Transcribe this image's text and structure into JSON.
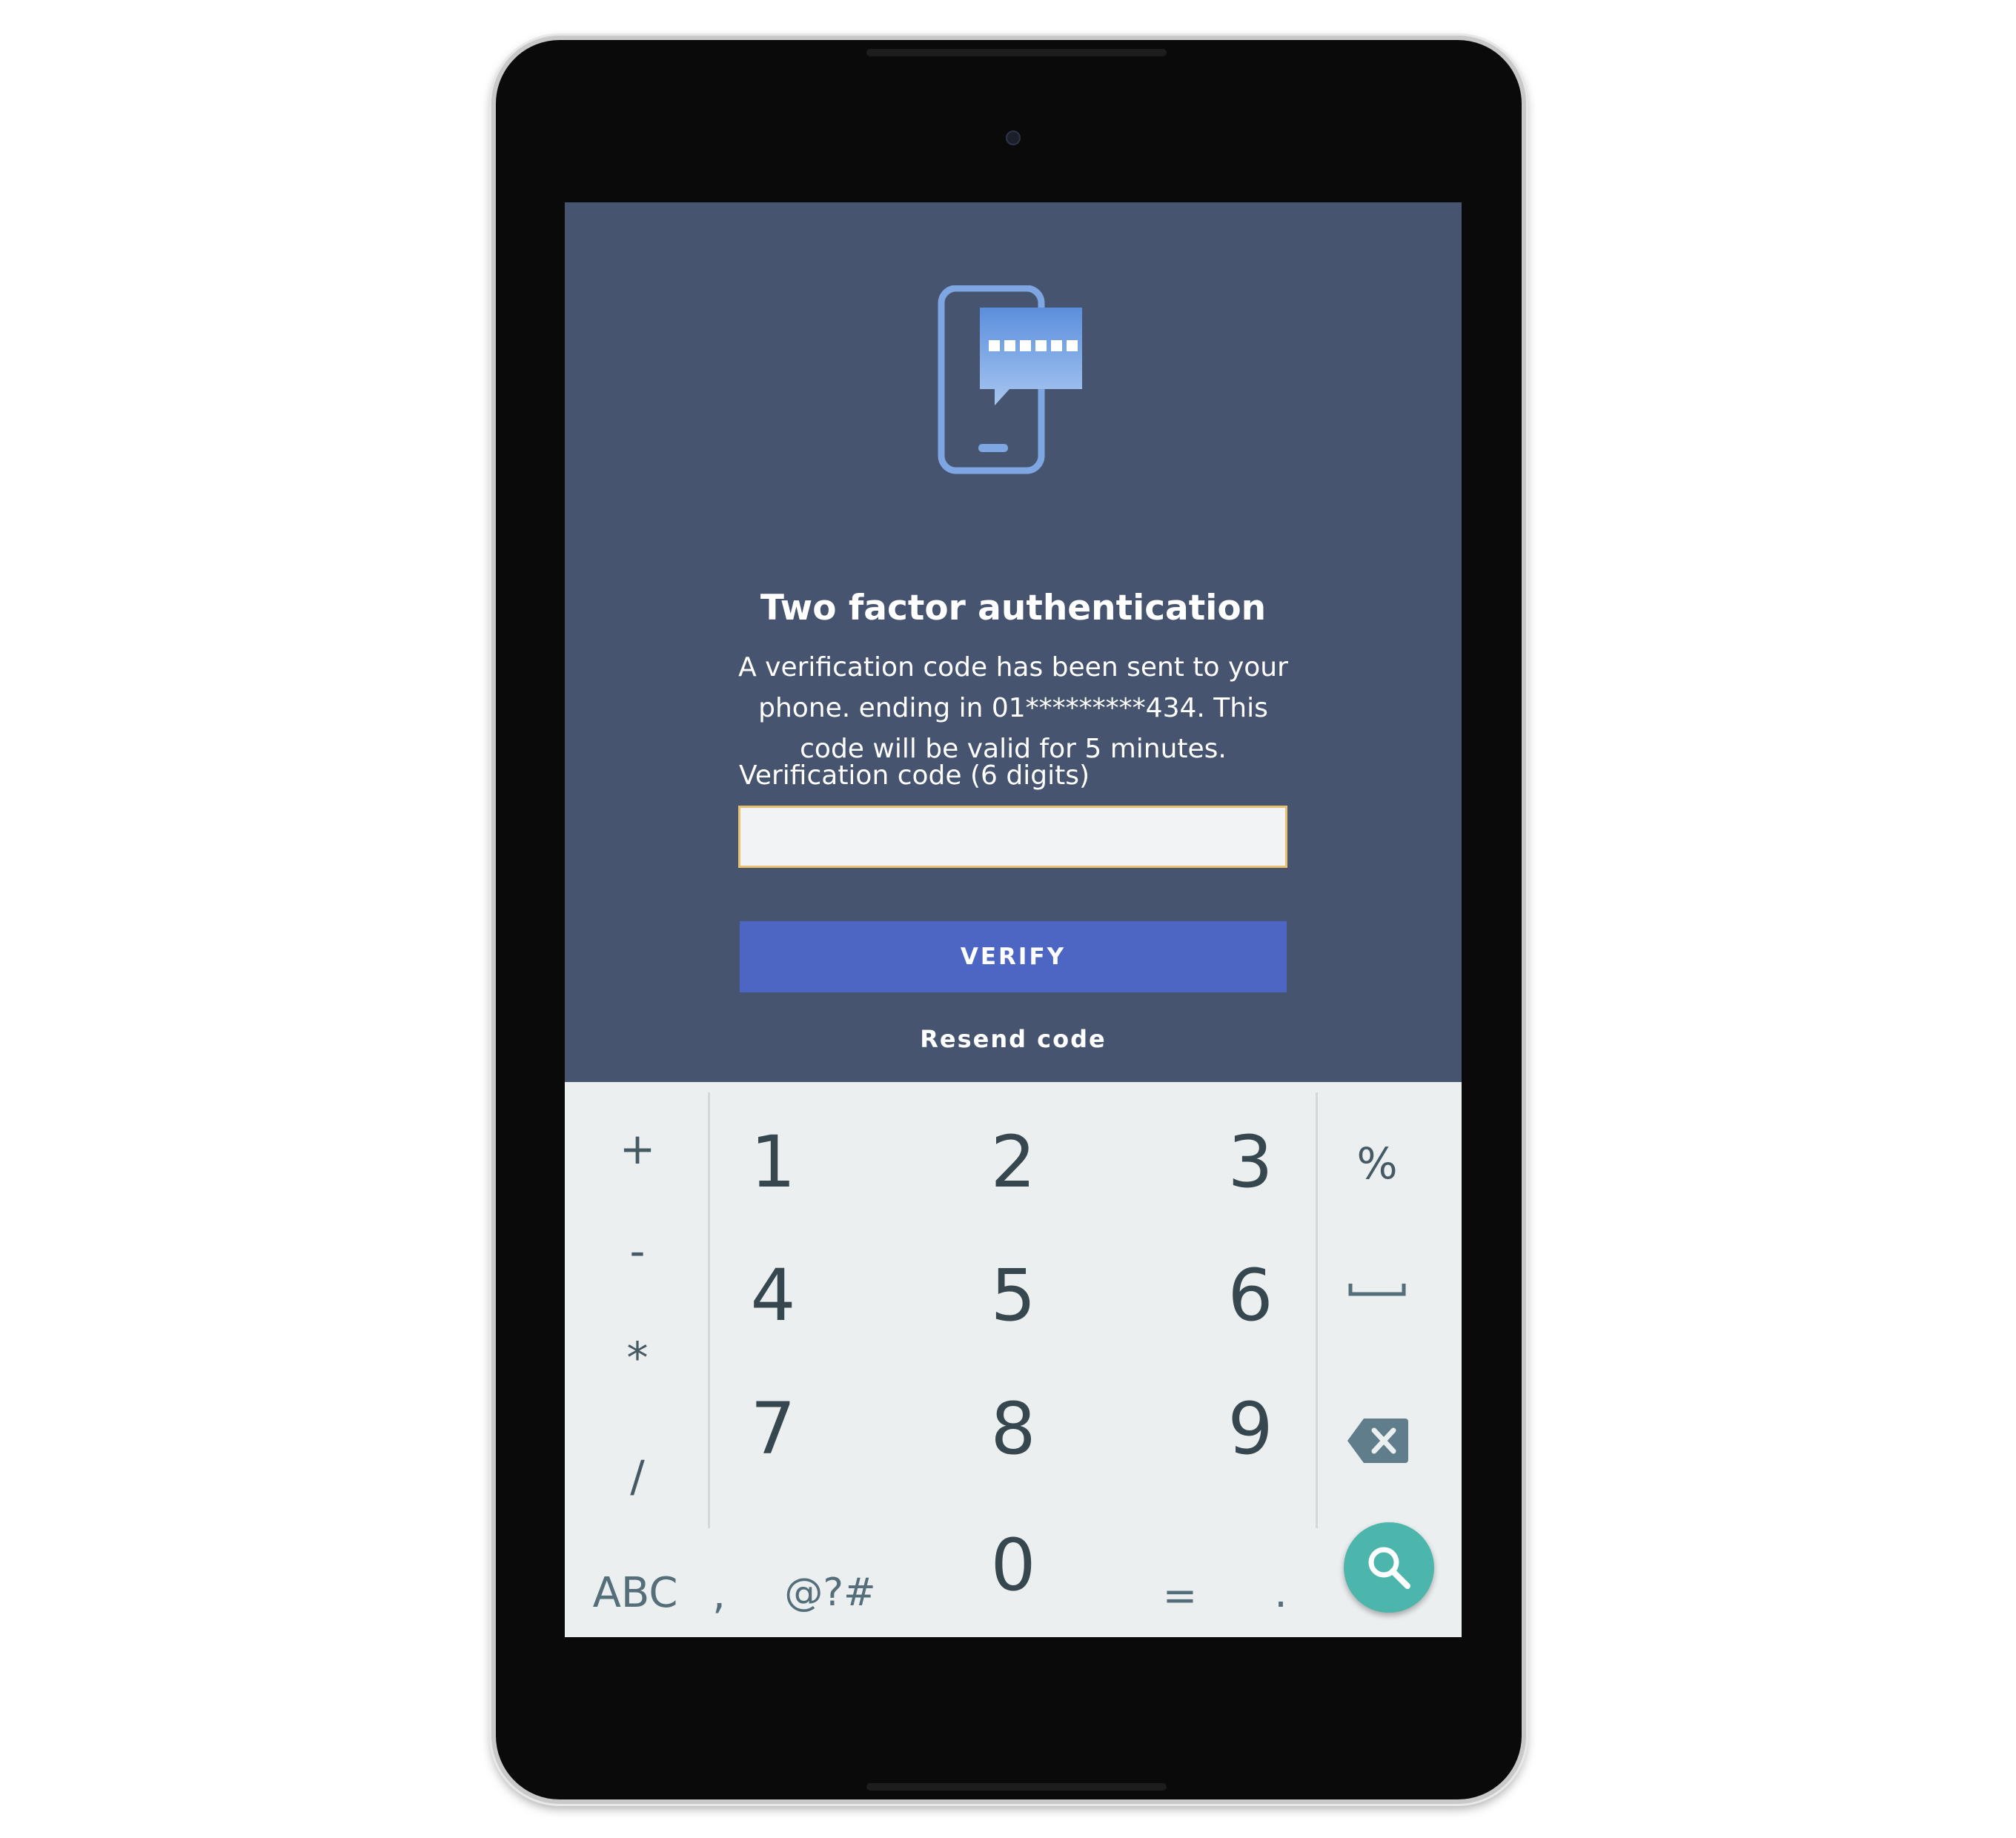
{
  "auth": {
    "title": "Two factor authentication",
    "description": "A verification code has been sent to your phone. ending in 01*********434. This code will be valid for 5 minutes.",
    "field_label": "Verification code (6 digits)",
    "code_value": "",
    "verify_label": "VERIFY",
    "resend_label": "Resend code",
    "icon": "phone-message-icon"
  },
  "keyboard": {
    "left_symbols": [
      "+",
      "-",
      "*",
      "/"
    ],
    "digits": [
      "1",
      "2",
      "3",
      "4",
      "5",
      "6",
      "7",
      "8",
      "9",
      "0"
    ],
    "right_keys": [
      "%",
      "space-icon",
      "backspace-icon"
    ],
    "abc_label": "ABC",
    "comma_label": ",",
    "symbols_label": "@?#",
    "equals_label": "=",
    "period_label": ".",
    "action_icon": "search-icon"
  },
  "colors": {
    "background": "#46546f",
    "button": "#4d66c4",
    "input_border": "#e8c170",
    "keyboard": "#eceff0",
    "fab": "#4db6ac"
  }
}
